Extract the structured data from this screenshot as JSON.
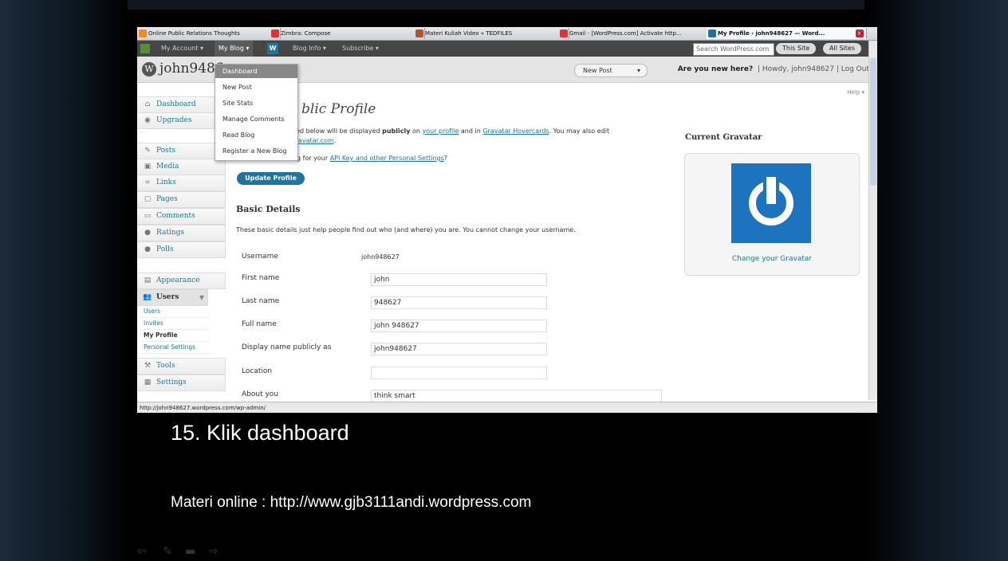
{
  "tabs": [
    {
      "label": "Online Public Relations Thoughts",
      "color": "#f28b1f"
    },
    {
      "label": "Zimbra: Compose",
      "color": "#d33"
    },
    {
      "label": "Materi Kuliah Video « TEDFILES",
      "color": "#a53"
    },
    {
      "label": "Gmail - [WordPress.com] Activate http...",
      "color": "#d33"
    },
    {
      "label": "My Profile ‹ john948627 — Word...",
      "color": "#21759b"
    }
  ],
  "adminbar": {
    "my_account": "My Account ▾",
    "my_blog": "My Blog ▾",
    "blog_info": "Blog Info ▾",
    "subscribe": "Subscribe ▾",
    "search_placeholder": "Search WordPress.com",
    "this_site": "This Site",
    "all_sites": "All Sites"
  },
  "header": {
    "blog_name": "john9486",
    "new_post": "New Post",
    "new_here": "Are you new here?",
    "howdy": "| Howdy, john948627 | Log Out"
  },
  "dropdown": [
    "Dashboard",
    "New Post",
    "Site Stats",
    "Manage Comments",
    "Read Blog",
    "Register a New Blog"
  ],
  "sidebar": {
    "dashboard": "Dashboard",
    "upgrades": "Upgrades",
    "posts": "Posts",
    "media": "Media",
    "links": "Links",
    "pages": "Pages",
    "comments": "Comments",
    "ratings": "Ratings",
    "polls": "Polls",
    "appearance": "Appearance",
    "users": "Users",
    "sub_users": "Users",
    "sub_invites": "Invites",
    "sub_profile": "My Profile",
    "sub_personal": "Personal Settings",
    "tools": "Tools",
    "settings": "Settings"
  },
  "content": {
    "help": "Help ▾",
    "title": "blic Profile",
    "intro_1a": "red below will be displayed ",
    "intro_1b": "publicly",
    "intro_1c": " on ",
    "intro_link1": "your profile",
    "intro_1d": " and in ",
    "intro_link2": "Gravatar Hovercards",
    "intro_1e": ". You may also edit",
    "intro_link3": "avatar.com",
    "intro_2a": "g for your ",
    "intro_link4": "API Key and other Personal Settings",
    "intro_2b": "?",
    "update_button": "Update Profile",
    "basic_details": "Basic Details",
    "basic_desc": "These basic details just help people find out who (and where) you are. You cannot change your username.",
    "username_label": "Username",
    "username_value": "john948627",
    "first_name_label": "First name",
    "first_name_value": "john",
    "last_name_label": "Last name",
    "last_name_value": "948627",
    "full_name_label": "Full name",
    "full_name_value": "john 948627",
    "display_name_label": "Display name publicly as",
    "display_name_value": "john948627",
    "location_label": "Location",
    "location_value": "",
    "about_label": "About you",
    "about_value": "think smart",
    "gravatar_title": "Current Gravatar",
    "gravatar_link": "Change your Gravatar"
  },
  "statusbar": "http://john948627.wordpress.com/wp-admin/",
  "slide": {
    "caption": "15. Klik dashboard",
    "materi": "Materi online : http://www.gjb3111andi.wordpress.com"
  }
}
